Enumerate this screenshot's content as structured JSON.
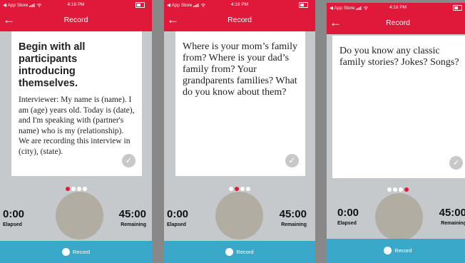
{
  "status_bar": {
    "carrier": "◀ App Store",
    "time": "4:18 PM"
  },
  "navbar": {
    "back_icon": "←",
    "title": "Record"
  },
  "screens": [
    {
      "prompt": "Begin with all participants introducing themselves.",
      "script": "Interviewer: My name is (name). I am (age) years old. Today is (date), and I'm speaking with (partner's name) who is my (relationship). We are recording this interview in (city), (state).",
      "active_dot": 0
    },
    {
      "prompt": "Where is your mom’s family from? Where is your dad’s family from? Your grandparents families? What do you know about them?",
      "active_dot": 1
    },
    {
      "prompt": "Do you know any classic family stories? Jokes? Songs?",
      "active_dot": 3
    }
  ],
  "timer": {
    "elapsed_value": "0:00",
    "elapsed_label": "Elapsed",
    "remaining_value": "45:00",
    "remaining_label": "Remaining"
  },
  "record_button": {
    "label": "Record"
  },
  "icons": {
    "check": "✓",
    "back": "arrow-left-icon",
    "wifi": "wifi-icon",
    "signal": "signal-icon",
    "battery": "battery-icon"
  },
  "colors": {
    "header": "#e0183a",
    "record_bar": "#3aa9c9",
    "active_dot": "#e0183a",
    "background": "#c5c9cc"
  }
}
